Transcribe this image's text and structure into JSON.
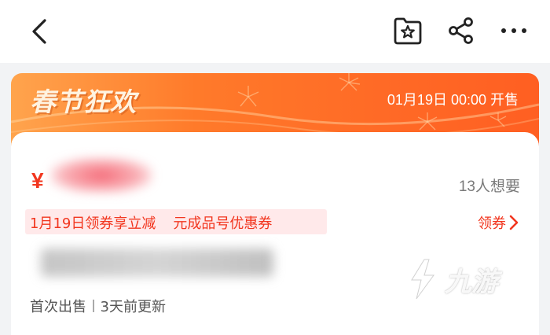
{
  "header": {
    "back_icon": "chevron-left-icon",
    "favorite_icon": "star-folder-icon",
    "share_icon": "share-icon",
    "more_icon": "more-dots-icon"
  },
  "banner": {
    "title": "春节狂欢",
    "sale_time": "01月19日 00:00 开售",
    "colors": {
      "start": "#ffa44d",
      "end": "#ff5f22"
    }
  },
  "listing": {
    "currency_symbol": "¥",
    "want_count": "13人想要",
    "coupon_text_before": "1月19日领券享立减",
    "coupon_text_after": "元成品号优惠券",
    "get_coupon_label": "领券",
    "first_sale": "首次出售",
    "updated": "3天前更新",
    "accent_color": "#f2361f"
  },
  "watermark": {
    "text": "九游"
  }
}
